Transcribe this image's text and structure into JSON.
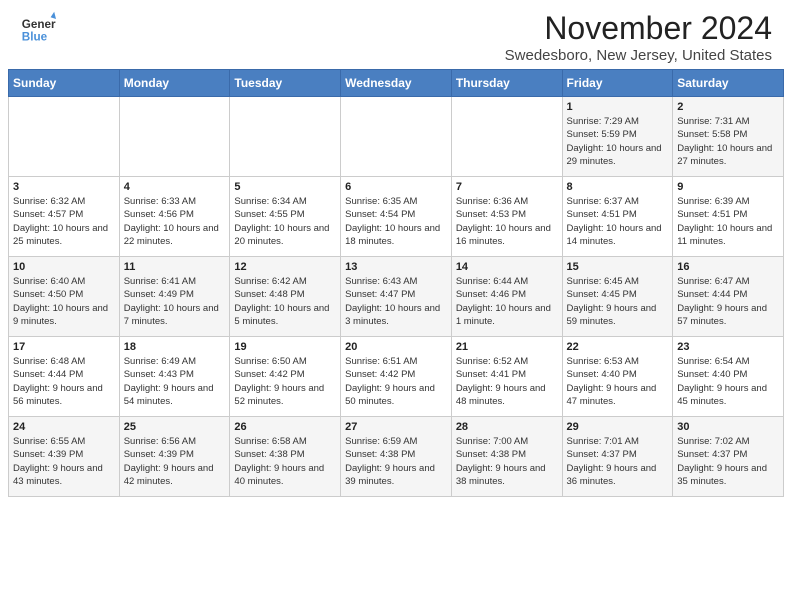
{
  "header": {
    "logo_general": "General",
    "logo_blue": "Blue",
    "month_year": "November 2024",
    "location": "Swedesboro, New Jersey, United States"
  },
  "calendar": {
    "days_of_week": [
      "Sunday",
      "Monday",
      "Tuesday",
      "Wednesday",
      "Thursday",
      "Friday",
      "Saturday"
    ],
    "weeks": [
      [
        {
          "day": "",
          "info": ""
        },
        {
          "day": "",
          "info": ""
        },
        {
          "day": "",
          "info": ""
        },
        {
          "day": "",
          "info": ""
        },
        {
          "day": "",
          "info": ""
        },
        {
          "day": "1",
          "info": "Sunrise: 7:29 AM\nSunset: 5:59 PM\nDaylight: 10 hours and 29 minutes."
        },
        {
          "day": "2",
          "info": "Sunrise: 7:31 AM\nSunset: 5:58 PM\nDaylight: 10 hours and 27 minutes."
        }
      ],
      [
        {
          "day": "3",
          "info": "Sunrise: 6:32 AM\nSunset: 4:57 PM\nDaylight: 10 hours and 25 minutes."
        },
        {
          "day": "4",
          "info": "Sunrise: 6:33 AM\nSunset: 4:56 PM\nDaylight: 10 hours and 22 minutes."
        },
        {
          "day": "5",
          "info": "Sunrise: 6:34 AM\nSunset: 4:55 PM\nDaylight: 10 hours and 20 minutes."
        },
        {
          "day": "6",
          "info": "Sunrise: 6:35 AM\nSunset: 4:54 PM\nDaylight: 10 hours and 18 minutes."
        },
        {
          "day": "7",
          "info": "Sunrise: 6:36 AM\nSunset: 4:53 PM\nDaylight: 10 hours and 16 minutes."
        },
        {
          "day": "8",
          "info": "Sunrise: 6:37 AM\nSunset: 4:51 PM\nDaylight: 10 hours and 14 minutes."
        },
        {
          "day": "9",
          "info": "Sunrise: 6:39 AM\nSunset: 4:51 PM\nDaylight: 10 hours and 11 minutes."
        }
      ],
      [
        {
          "day": "10",
          "info": "Sunrise: 6:40 AM\nSunset: 4:50 PM\nDaylight: 10 hours and 9 minutes."
        },
        {
          "day": "11",
          "info": "Sunrise: 6:41 AM\nSunset: 4:49 PM\nDaylight: 10 hours and 7 minutes."
        },
        {
          "day": "12",
          "info": "Sunrise: 6:42 AM\nSunset: 4:48 PM\nDaylight: 10 hours and 5 minutes."
        },
        {
          "day": "13",
          "info": "Sunrise: 6:43 AM\nSunset: 4:47 PM\nDaylight: 10 hours and 3 minutes."
        },
        {
          "day": "14",
          "info": "Sunrise: 6:44 AM\nSunset: 4:46 PM\nDaylight: 10 hours and 1 minute."
        },
        {
          "day": "15",
          "info": "Sunrise: 6:45 AM\nSunset: 4:45 PM\nDaylight: 9 hours and 59 minutes."
        },
        {
          "day": "16",
          "info": "Sunrise: 6:47 AM\nSunset: 4:44 PM\nDaylight: 9 hours and 57 minutes."
        }
      ],
      [
        {
          "day": "17",
          "info": "Sunrise: 6:48 AM\nSunset: 4:44 PM\nDaylight: 9 hours and 56 minutes."
        },
        {
          "day": "18",
          "info": "Sunrise: 6:49 AM\nSunset: 4:43 PM\nDaylight: 9 hours and 54 minutes."
        },
        {
          "day": "19",
          "info": "Sunrise: 6:50 AM\nSunset: 4:42 PM\nDaylight: 9 hours and 52 minutes."
        },
        {
          "day": "20",
          "info": "Sunrise: 6:51 AM\nSunset: 4:42 PM\nDaylight: 9 hours and 50 minutes."
        },
        {
          "day": "21",
          "info": "Sunrise: 6:52 AM\nSunset: 4:41 PM\nDaylight: 9 hours and 48 minutes."
        },
        {
          "day": "22",
          "info": "Sunrise: 6:53 AM\nSunset: 4:40 PM\nDaylight: 9 hours and 47 minutes."
        },
        {
          "day": "23",
          "info": "Sunrise: 6:54 AM\nSunset: 4:40 PM\nDaylight: 9 hours and 45 minutes."
        }
      ],
      [
        {
          "day": "24",
          "info": "Sunrise: 6:55 AM\nSunset: 4:39 PM\nDaylight: 9 hours and 43 minutes."
        },
        {
          "day": "25",
          "info": "Sunrise: 6:56 AM\nSunset: 4:39 PM\nDaylight: 9 hours and 42 minutes."
        },
        {
          "day": "26",
          "info": "Sunrise: 6:58 AM\nSunset: 4:38 PM\nDaylight: 9 hours and 40 minutes."
        },
        {
          "day": "27",
          "info": "Sunrise: 6:59 AM\nSunset: 4:38 PM\nDaylight: 9 hours and 39 minutes."
        },
        {
          "day": "28",
          "info": "Sunrise: 7:00 AM\nSunset: 4:38 PM\nDaylight: 9 hours and 38 minutes."
        },
        {
          "day": "29",
          "info": "Sunrise: 7:01 AM\nSunset: 4:37 PM\nDaylight: 9 hours and 36 minutes."
        },
        {
          "day": "30",
          "info": "Sunrise: 7:02 AM\nSunset: 4:37 PM\nDaylight: 9 hours and 35 minutes."
        }
      ]
    ]
  }
}
